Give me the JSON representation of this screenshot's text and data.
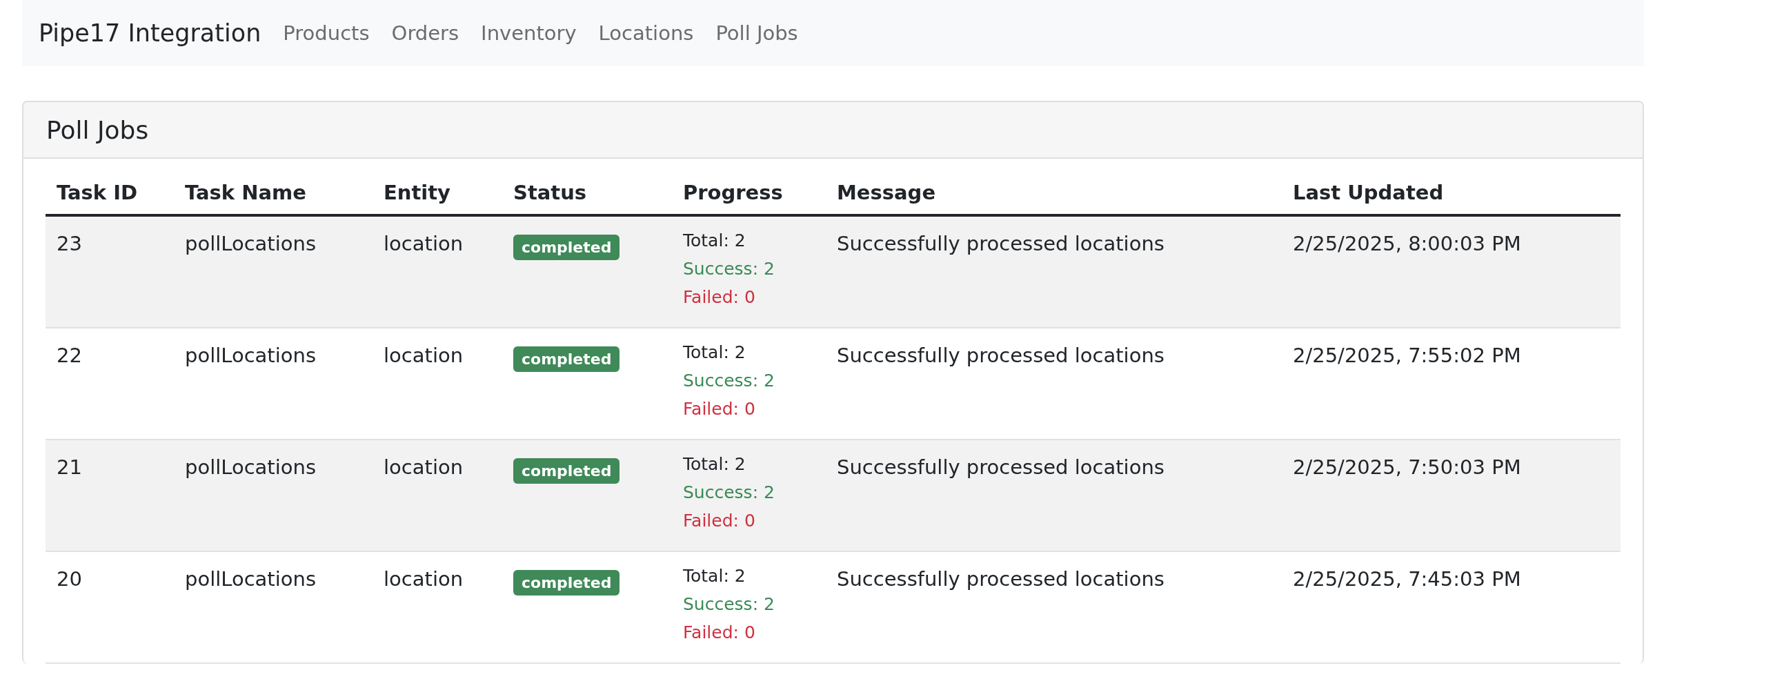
{
  "navbar": {
    "brand": "Pipe17 Integration",
    "links": [
      {
        "label": "Products"
      },
      {
        "label": "Orders"
      },
      {
        "label": "Inventory"
      },
      {
        "label": "Locations"
      },
      {
        "label": "Poll Jobs"
      }
    ]
  },
  "card": {
    "title": "Poll Jobs",
    "table": {
      "columns": [
        "Task ID",
        "Task Name",
        "Entity",
        "Status",
        "Progress",
        "Message",
        "Last Updated"
      ],
      "rows": [
        {
          "task_id": "23",
          "task_name": "pollLocations",
          "entity": "location",
          "status": {
            "label": "completed",
            "kind": "success"
          },
          "progress": {
            "total": "Total: 2",
            "success": "Success: 2",
            "failed": "Failed: 0"
          },
          "message": "Successfully processed locations",
          "last_updated": "2/25/2025, 8:00:03 PM"
        },
        {
          "task_id": "22",
          "task_name": "pollLocations",
          "entity": "location",
          "status": {
            "label": "completed",
            "kind": "success"
          },
          "progress": {
            "total": "Total: 2",
            "success": "Success: 2",
            "failed": "Failed: 0"
          },
          "message": "Successfully processed locations",
          "last_updated": "2/25/2025, 7:55:02 PM"
        },
        {
          "task_id": "21",
          "task_name": "pollLocations",
          "entity": "location",
          "status": {
            "label": "completed",
            "kind": "success"
          },
          "progress": {
            "total": "Total: 2",
            "success": "Success: 2",
            "failed": "Failed: 0"
          },
          "message": "Successfully processed locations",
          "last_updated": "2/25/2025, 7:50:03 PM"
        },
        {
          "task_id": "20",
          "task_name": "pollLocations",
          "entity": "location",
          "status": {
            "label": "completed",
            "kind": "success"
          },
          "progress": {
            "total": "Total: 2",
            "success": "Success: 2",
            "failed": "Failed: 0"
          },
          "message": "Successfully processed locations",
          "last_updated": "2/25/2025, 7:45:03 PM"
        }
      ]
    }
  }
}
